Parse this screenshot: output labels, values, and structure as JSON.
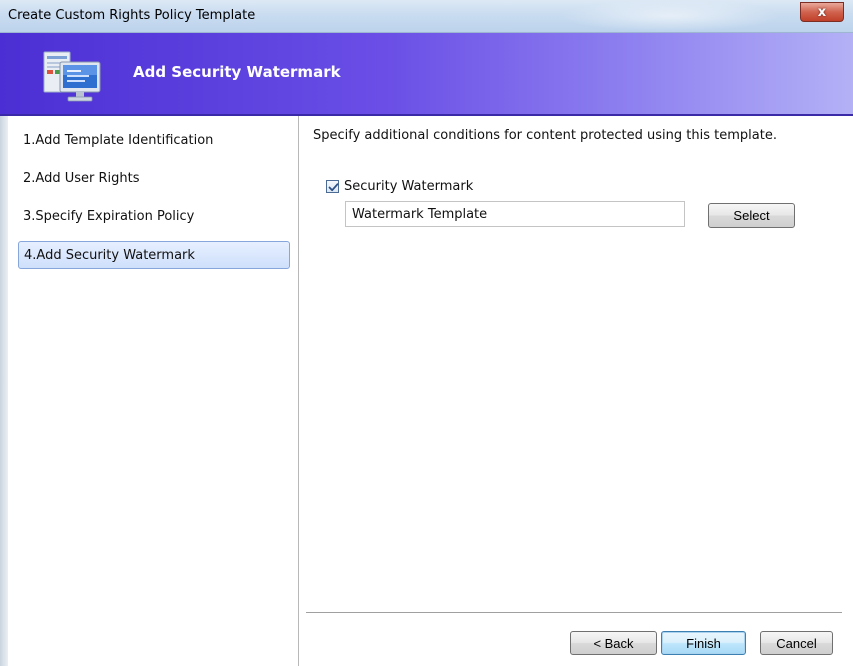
{
  "window": {
    "title": "Create Custom Rights Policy Template",
    "close_label": "x"
  },
  "banner": {
    "title": "Add Security Watermark",
    "icon": "computer-monitor-icon"
  },
  "nav": {
    "items": [
      {
        "label": "1.Add Template Identification",
        "selected": false
      },
      {
        "label": "2.Add User Rights",
        "selected": false
      },
      {
        "label": "3.Specify Expiration Policy",
        "selected": false
      },
      {
        "label": "4.Add Security Watermark",
        "selected": true
      }
    ]
  },
  "content": {
    "instruction": "Specify additional conditions for content protected using this template.",
    "watermark_checkbox": {
      "label": "Security Watermark",
      "checked": true
    },
    "watermark_field": {
      "value": "Watermark Template"
    },
    "select_label": "Select"
  },
  "footer": {
    "back_label": "< Back",
    "finish_label": "Finish",
    "cancel_label": "Cancel"
  },
  "colors": {
    "banner_start": "#4b2fd4",
    "banner_end": "#b4b1f6",
    "selected_nav": "#cfe0fb",
    "close_button": "#c0402a"
  }
}
